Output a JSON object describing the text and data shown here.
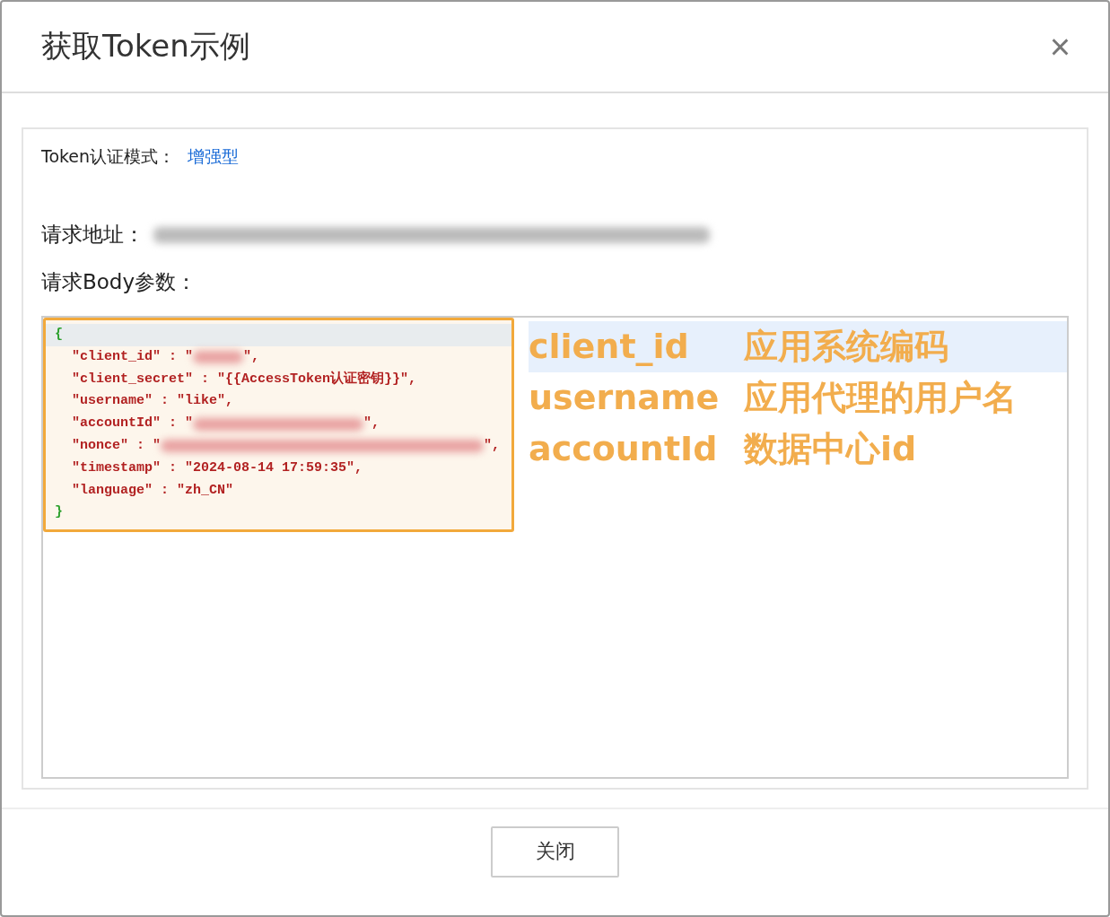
{
  "dialog": {
    "title": "获取Token示例",
    "close_label": "×"
  },
  "auth_mode": {
    "label": "Token认证模式：",
    "value": "增强型"
  },
  "request_url": {
    "label": "请求地址：",
    "kind": "blurred"
  },
  "body_label": "请求Body参数：",
  "code_lines": [
    {
      "kind": "brace",
      "parts": [
        {
          "kind": "text",
          "text": "{"
        }
      ]
    },
    {
      "kind": "pair",
      "parts": [
        {
          "kind": "text",
          "text": "\"client_id\" : \""
        },
        {
          "kind": "blur_short"
        },
        {
          "kind": "text",
          "text": "\","
        }
      ]
    },
    {
      "kind": "pair",
      "parts": [
        {
          "kind": "text",
          "text": "\"client_secret\" : \"{{AccessToken认证密钥}}\","
        }
      ]
    },
    {
      "kind": "pair",
      "parts": [
        {
          "kind": "text",
          "text": "\"username\" : \"like\","
        }
      ]
    },
    {
      "kind": "pair",
      "parts": [
        {
          "kind": "text",
          "text": "\"accountId\" : \""
        },
        {
          "kind": "blur_medium"
        },
        {
          "kind": "text",
          "text": "\","
        }
      ]
    },
    {
      "kind": "pair",
      "parts": [
        {
          "kind": "text",
          "text": "\"nonce\" : \""
        },
        {
          "kind": "blur_long"
        },
        {
          "kind": "text",
          "text": "\","
        }
      ]
    },
    {
      "kind": "pair",
      "parts": [
        {
          "kind": "text",
          "text": "\"timestamp\" : \"2024-08-14 17:59:35\","
        }
      ]
    },
    {
      "kind": "pair",
      "parts": [
        {
          "kind": "text",
          "text": "\"language\" : \"zh_CN\""
        }
      ]
    },
    {
      "kind": "brace",
      "parts": [
        {
          "kind": "text",
          "text": "}"
        }
      ]
    }
  ],
  "annotations": [
    {
      "name": "client_id",
      "description": "应用系统编码",
      "highlighted": true
    },
    {
      "name": "username",
      "description": "应用代理的用户名",
      "highlighted": false
    },
    {
      "name": "accountId",
      "description": "数据中心id",
      "highlighted": false
    }
  ],
  "buttons": [
    "关闭"
  ]
}
